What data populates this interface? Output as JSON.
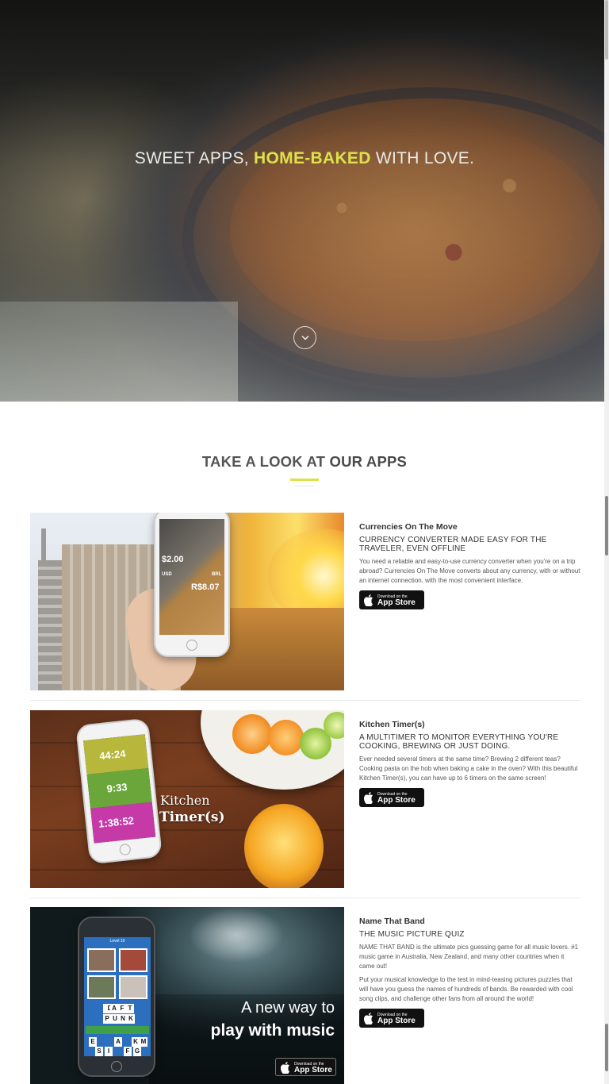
{
  "hero": {
    "headline_before": "SWEET APPS,",
    "headline_highlight": "HOME-BAKED",
    "headline_after": "WITH LOVE.",
    "accent": "#dde24a"
  },
  "apps_section": {
    "title_light": "TAKE A LOOK AT",
    "title_bold": "OUR APPS"
  },
  "appstore_badge": {
    "small": "Download on the",
    "big": "App Store"
  },
  "apps": [
    {
      "name": "Currencies On The Move",
      "tagline": "CURRENCY CONVERTER MADE EASY FOR THE TRAVELER, EVEN OFFLINE",
      "description": "You need a reliable and easy-to-use currency converter when you're on a trip abroad? Currencies On The Move converts about any currency, with or without an internet connection, with the most convenient interface.",
      "screen_amount_1": "$2.00",
      "screen_code_1": "USD",
      "screen_code_2": "BRL",
      "screen_amount_2": "R$8.07"
    },
    {
      "name": "Kitchen Timer(s)",
      "tagline": "A MULTITIMER TO MONITOR EVERYTHING YOU'RE COOKING, BREWING OR JUST DOING.",
      "description": "Ever needed several timers at the same time? Brewing 2 different teas? Cooking pasta on the hob when baking a cake in the oven? With this beautiful Kitchen Timer(s), you can have up to 6 timers on the same screen!",
      "timers": [
        "44:24",
        "9:33",
        "1:38:52"
      ],
      "overlay_line1": "Kitchen",
      "overlay_line2": "Timer(s)"
    },
    {
      "name": "Name That Band",
      "tagline": "THE MUSIC PICTURE QUIZ",
      "description": "NAME THAT BAND is the ultimate pics guessing game for all music lovers. #1 music game in Australia, New Zealand, and many other countries when it came out!",
      "description2": "Put your musical knowledge to the test in mind-teasing pictures puzzles that will have you guess the names of hundreds of bands. Be rewarded with cool song clips, and challenge other fans from all around the world!",
      "overlay_line1": "A new way to",
      "overlay_line2": "play with music",
      "level_label": "Level 10",
      "answer_row1": [
        "D",
        "A",
        "F",
        "T"
      ],
      "answer_row2": [
        "P",
        "U",
        "N",
        "K"
      ],
      "letters": [
        "E",
        "A",
        "K",
        "M",
        "S",
        "I",
        "F",
        "G"
      ]
    }
  ]
}
